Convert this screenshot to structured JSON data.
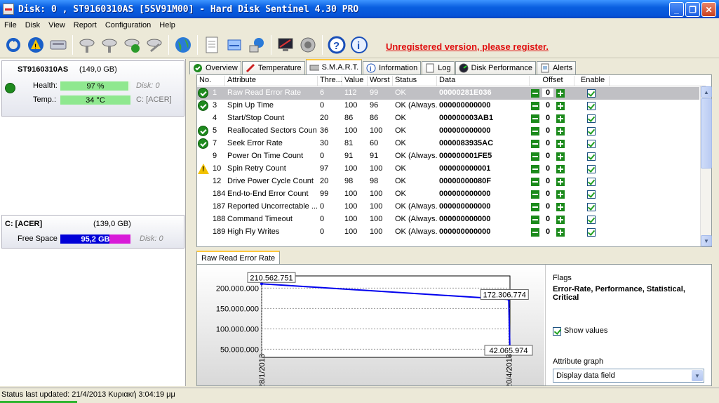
{
  "window": {
    "title": "Disk: 0 , ST9160310AS [5SV91M00]  -  Hard Disk Sentinel 4.30 PRO"
  },
  "menu": [
    "File",
    "Disk",
    "View",
    "Report",
    "Configuration",
    "Help"
  ],
  "toolbar": {
    "unregistered": "Unregistered version, please register."
  },
  "disk": {
    "name": "ST9160310AS",
    "size": "(149,0 GB)",
    "health_label": "Health:",
    "health_value": "97 %",
    "health_pct": 97,
    "disk_ref": "Disk: 0",
    "temp_label": "Temp.:",
    "temp_value": "34 °C",
    "volume_ref": "C: [ACER]"
  },
  "volume": {
    "name": "C: [ACER]",
    "size": "(139,0 GB)",
    "free_label": "Free Space",
    "free_value": "95,2 GB",
    "disk_ref": "Disk: 0"
  },
  "tabs": [
    "Overview",
    "Temperature",
    "S.M.A.R.T.",
    "Information",
    "Log",
    "Disk Performance",
    "Alerts"
  ],
  "columns": [
    "No.",
    "Attribute",
    "Thre...",
    "Value",
    "Worst",
    "Status",
    "Data",
    "Offset",
    "Enable"
  ],
  "rows": [
    {
      "no": "1",
      "attr": "Raw Read Error Rate",
      "thr": "6",
      "val": "112",
      "worst": "99",
      "status": "OK",
      "data": "00000281E036",
      "off": "0",
      "icon": "ok"
    },
    {
      "no": "3",
      "attr": "Spin Up Time",
      "thr": "0",
      "val": "100",
      "worst": "96",
      "status": "OK (Always...",
      "data": "000000000000",
      "off": "0",
      "icon": "ok"
    },
    {
      "no": "4",
      "attr": "Start/Stop Count",
      "thr": "20",
      "val": "86",
      "worst": "86",
      "status": "OK",
      "data": "000000003AB1",
      "off": "0",
      "icon": ""
    },
    {
      "no": "5",
      "attr": "Reallocated Sectors Count",
      "thr": "36",
      "val": "100",
      "worst": "100",
      "status": "OK",
      "data": "000000000000",
      "off": "0",
      "icon": "ok"
    },
    {
      "no": "7",
      "attr": "Seek Error Rate",
      "thr": "30",
      "val": "81",
      "worst": "60",
      "status": "OK",
      "data": "0000083935AC",
      "off": "0",
      "icon": "ok"
    },
    {
      "no": "9",
      "attr": "Power On Time Count",
      "thr": "0",
      "val": "91",
      "worst": "91",
      "status": "OK (Always...",
      "data": "000000001FE5",
      "off": "0",
      "icon": ""
    },
    {
      "no": "10",
      "attr": "Spin Retry Count",
      "thr": "97",
      "val": "100",
      "worst": "100",
      "status": "OK",
      "data": "000000000001",
      "off": "0",
      "icon": "warn"
    },
    {
      "no": "12",
      "attr": "Drive Power Cycle Count",
      "thr": "20",
      "val": "98",
      "worst": "98",
      "status": "OK",
      "data": "00000000080F",
      "off": "0",
      "icon": ""
    },
    {
      "no": "184",
      "attr": "End-to-End Error Count",
      "thr": "99",
      "val": "100",
      "worst": "100",
      "status": "OK",
      "data": "000000000000",
      "off": "0",
      "icon": ""
    },
    {
      "no": "187",
      "attr": "Reported Uncorrectable ...",
      "thr": "0",
      "val": "100",
      "worst": "100",
      "status": "OK (Always...",
      "data": "000000000000",
      "off": "0",
      "icon": ""
    },
    {
      "no": "188",
      "attr": "Command Timeout",
      "thr": "0",
      "val": "100",
      "worst": "100",
      "status": "OK (Always...",
      "data": "000000000000",
      "off": "0",
      "icon": ""
    },
    {
      "no": "189",
      "attr": "High Fly Writes",
      "thr": "0",
      "val": "100",
      "worst": "100",
      "status": "OK (Always...",
      "data": "000000000000",
      "off": "0",
      "icon": ""
    }
  ],
  "graph": {
    "tab": "Raw Read Error Rate",
    "flags_label": "Flags",
    "flags_value": "Error-Rate, Performance, Statistical, Critical",
    "show_values": "Show values",
    "attr_graph_label": "Attribute graph",
    "attr_graph_value": "Display data field"
  },
  "chart_data": {
    "type": "line",
    "x": [
      "28/1/2013",
      "20/4/2013",
      "20/4/2013"
    ],
    "x_days": [
      0,
      81,
      81.4
    ],
    "values": [
      210562751,
      172306774,
      42065974
    ],
    "value_labels": [
      "210.562.751",
      "172.306.774",
      "42.065.974"
    ],
    "yticks": [
      50000000,
      100000000,
      150000000,
      200000000
    ],
    "ytick_labels": [
      "50.000.000",
      "100.000.000",
      "150.000.000",
      "200.000.000"
    ],
    "xtick_labels": [
      "28/1/2013",
      "20/4/2013"
    ],
    "ylim": [
      30000000,
      230000000
    ],
    "grid": true,
    "line_color": "#0000ee"
  },
  "status": {
    "text": "Status last updated: 21/4/2013 Κυριακή 3:04:19 μμ"
  }
}
